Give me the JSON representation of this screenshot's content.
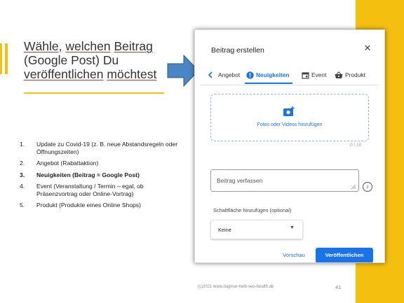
{
  "slide": {
    "title_parts": [
      "Wähle",
      ", ",
      "welchen",
      " ",
      "Beitrag",
      " (Google Post) Du ",
      "veröffentlichen",
      " ",
      "möchtest"
    ],
    "list": [
      {
        "num": "1.",
        "text": "Update zu Covid-19 (z. B. neue Abstandsregeln oder Öffnungszeiten)"
      },
      {
        "num": "2.",
        "text": "Angebot (Rabattaktion)"
      },
      {
        "num": "3.",
        "text": "Neuigkeiten (Beitrag = Google Post)"
      },
      {
        "num": "4.",
        "text": "Event (Veranstaltung / Termin – egal, ob Präsenzvortrag oder Online-Vortrag)"
      },
      {
        "num": "5.",
        "text": "Produkt (Produkte eines Online Shops)"
      }
    ],
    "footer": "(c)2021 www.dagmar-helb-seo-health.de",
    "page_number": "41",
    "accent_color": "#f5bf10",
    "arrow_color": "#4a86c5"
  },
  "dialog": {
    "title": "Beitrag erstellen",
    "close_icon": "close-icon",
    "tabs": [
      {
        "label": "Angebot",
        "icon": "chevron-left-icon",
        "active": false
      },
      {
        "label": "Neuigkeiten",
        "icon": "alert-icon",
        "active": true
      },
      {
        "label": "Event",
        "icon": "calendar-icon",
        "active": false
      },
      {
        "label": "Produkt",
        "icon": "shopping-basket-icon",
        "active": false
      }
    ],
    "upload": {
      "label": "Fotos oder Videos hinzufügen",
      "counter": "0 / 10",
      "icon": "add-photo-icon"
    },
    "post_field": {
      "placeholder": "Beitrag verfassen",
      "value": ""
    },
    "cta": {
      "heading": "Schaltfläche hinzufügen (optional)",
      "selected": "Keine"
    },
    "buttons": {
      "preview": "Vorschau",
      "publish": "Veröffentlichen"
    },
    "accent_color": "#1a73e8"
  }
}
